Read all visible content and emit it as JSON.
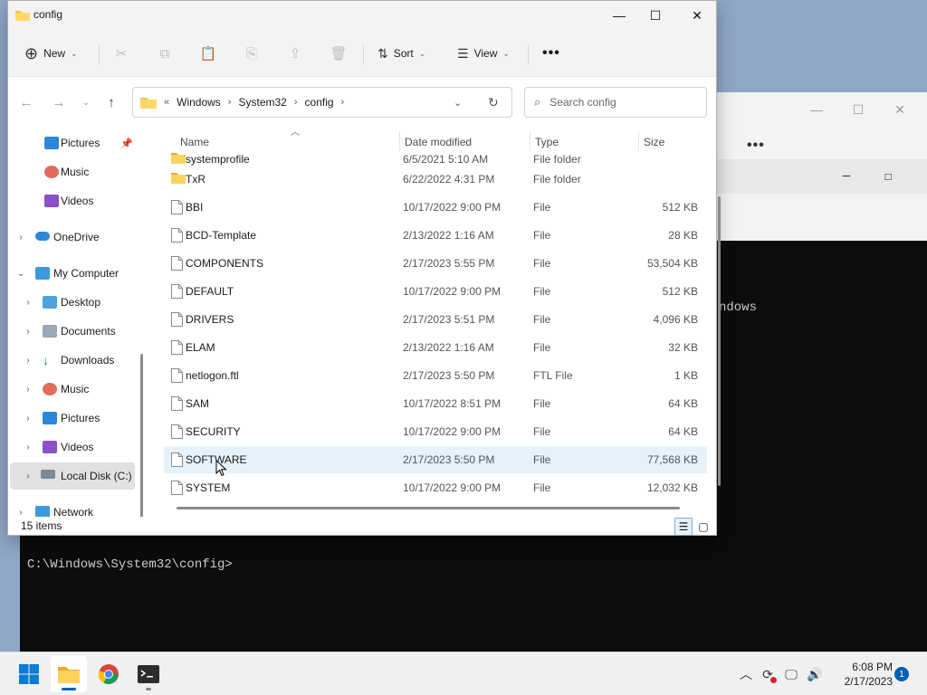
{
  "explorer": {
    "title": "config",
    "toolbar": {
      "new_label": "New",
      "sort_label": "Sort",
      "view_label": "View"
    },
    "breadcrumb": [
      "Windows",
      "System32",
      "config"
    ],
    "search_placeholder": "Search config",
    "nav": [
      {
        "label": "Pictures",
        "icon": "pictures-icon",
        "pinned": true
      },
      {
        "label": "Music",
        "icon": "music-icon"
      },
      {
        "label": "Videos",
        "icon": "videos-icon"
      },
      {
        "label": "OneDrive",
        "icon": "onedrive-icon"
      },
      {
        "label": "My Computer",
        "icon": "computer-icon"
      },
      {
        "label": "Desktop",
        "icon": "desktop-icon"
      },
      {
        "label": "Documents",
        "icon": "documents-icon"
      },
      {
        "label": "Downloads",
        "icon": "downloads-icon"
      },
      {
        "label": "Music",
        "icon": "music-icon"
      },
      {
        "label": "Pictures",
        "icon": "pictures-icon"
      },
      {
        "label": "Videos",
        "icon": "videos-icon"
      },
      {
        "label": "Local Disk (C:)",
        "icon": "drive-icon"
      },
      {
        "label": "Network",
        "icon": "network-icon"
      }
    ],
    "columns": {
      "name": "Name",
      "date": "Date modified",
      "type": "Type",
      "size": "Size"
    },
    "files": [
      {
        "name": "systemprofile",
        "date": "6/5/2021 5:10 AM",
        "type": "File folder",
        "size": "",
        "kind": "folder"
      },
      {
        "name": "TxR",
        "date": "6/22/2022 4:31 PM",
        "type": "File folder",
        "size": "",
        "kind": "folder"
      },
      {
        "name": "BBI",
        "date": "10/17/2022 9:00 PM",
        "type": "File",
        "size": "512 KB",
        "kind": "file"
      },
      {
        "name": "BCD-Template",
        "date": "2/13/2022 1:16 AM",
        "type": "File",
        "size": "28 KB",
        "kind": "file"
      },
      {
        "name": "COMPONENTS",
        "date": "2/17/2023 5:55 PM",
        "type": "File",
        "size": "53,504 KB",
        "kind": "file"
      },
      {
        "name": "DEFAULT",
        "date": "10/17/2022 9:00 PM",
        "type": "File",
        "size": "512 KB",
        "kind": "file"
      },
      {
        "name": "DRIVERS",
        "date": "2/17/2023 5:51 PM",
        "type": "File",
        "size": "4,096 KB",
        "kind": "file"
      },
      {
        "name": "ELAM",
        "date": "2/13/2022 1:16 AM",
        "type": "File",
        "size": "32 KB",
        "kind": "file"
      },
      {
        "name": "netlogon.ftl",
        "date": "2/17/2023 5:50 PM",
        "type": "FTL File",
        "size": "1 KB",
        "kind": "file"
      },
      {
        "name": "SAM",
        "date": "10/17/2022 8:51 PM",
        "type": "File",
        "size": "64 KB",
        "kind": "file"
      },
      {
        "name": "SECURITY",
        "date": "10/17/2022 9:00 PM",
        "type": "File",
        "size": "64 KB",
        "kind": "file"
      },
      {
        "name": "SOFTWARE",
        "date": "2/17/2023 5:50 PM",
        "type": "File",
        "size": "77,568 KB",
        "kind": "file",
        "hover": true
      },
      {
        "name": "SYSTEM",
        "date": "10/17/2022 9:00 PM",
        "type": "File",
        "size": "12,032 KB",
        "kind": "file"
      }
    ],
    "status": "15 items"
  },
  "terminal": {
    "partial_text": "ndows",
    "prompt": "C:\\Windows\\System32\\config>"
  },
  "taskbar": {
    "time": "6:08 PM",
    "date": "2/17/2023",
    "notification_count": "1"
  },
  "colors": {
    "accent": "#005fb8",
    "folder": "#f8c54a",
    "hover_row": "#e5f1fb"
  }
}
